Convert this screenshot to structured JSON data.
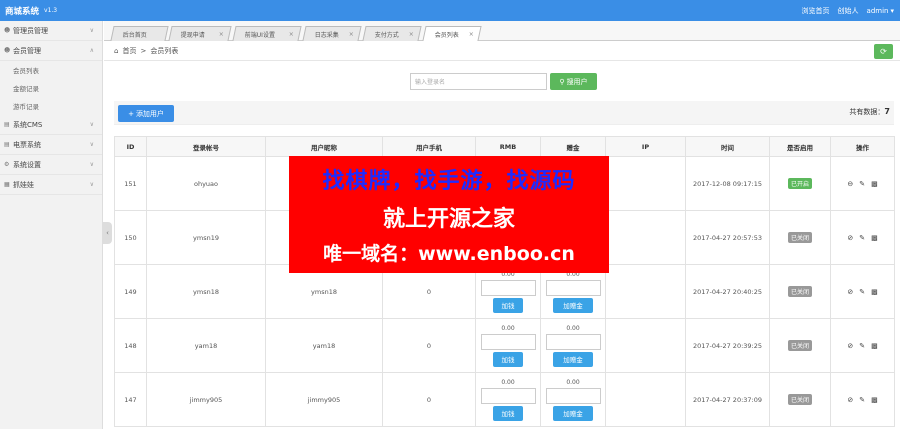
{
  "app": {
    "title": "商城系统",
    "version": "v1.3"
  },
  "header": {
    "links": [
      "浏览首页",
      "创始人"
    ],
    "user": "admin",
    "user_caret": "▾"
  },
  "sidebar": {
    "items": [
      {
        "label": "管理员管理",
        "icon": "user-icon"
      },
      {
        "label": "会员管理",
        "icon": "users-icon",
        "expanded": true,
        "children": [
          "会员列表",
          "金额记录",
          "游币记录"
        ]
      },
      {
        "label": "系统CMS",
        "icon": "cms-icon"
      },
      {
        "label": "电票系统",
        "icon": "ticket-icon"
      },
      {
        "label": "系统设置",
        "icon": "gear-icon"
      },
      {
        "label": "抓娃娃",
        "icon": "grid-icon"
      }
    ],
    "collapse_glyph": "‹"
  },
  "tabs": [
    {
      "label": "后台首页"
    },
    {
      "label": "提现申请"
    },
    {
      "label": "前端UI设置"
    },
    {
      "label": "日志采集"
    },
    {
      "label": "支付方式"
    },
    {
      "label": "会员列表",
      "active": true
    }
  ],
  "breadcrumb": {
    "home": "首页",
    "sep": ">",
    "current": "会员列表"
  },
  "search": {
    "placeholder": "输入登录名",
    "button_label": "搜用户",
    "button_icon": "search-icon"
  },
  "toolbar": {
    "add_label": "添加用户",
    "add_icon": "plus-icon",
    "total_label": "共有数据：",
    "total_value": "7"
  },
  "table": {
    "headers": [
      "ID",
      "登录帐号",
      "用户昵称",
      "用户手机",
      "RMB",
      "赠金",
      "IP",
      "时间",
      "是否启用",
      "操作"
    ],
    "rows": [
      {
        "id": "151",
        "login": "ohyuao",
        "nick": "",
        "phone": "",
        "rmb": "",
        "gift": "",
        "ip": "",
        "time": "2017-12-08 09:17:15",
        "status": "已开启",
        "status_type": "on"
      },
      {
        "id": "150",
        "login": "ymsn19",
        "nick": "",
        "phone": "",
        "rmb": "",
        "gift": "",
        "ip": "",
        "time": "2017-04-27 20:57:53",
        "status": "已关闭",
        "status_type": "off"
      },
      {
        "id": "149",
        "login": "ymsn18",
        "nick": "ymsn18",
        "phone": "0",
        "rmb": "0.00",
        "gift": "0.00",
        "ip": "",
        "time": "2017-04-27 20:40:25",
        "status": "已关闭",
        "status_type": "off"
      },
      {
        "id": "148",
        "login": "yam18",
        "nick": "yam18",
        "phone": "0",
        "rmb": "0.00",
        "gift": "0.00",
        "ip": "",
        "time": "2017-04-27 20:39:25",
        "status": "已关闭",
        "status_type": "off"
      },
      {
        "id": "147",
        "login": "jimmy905",
        "nick": "jimmy905",
        "phone": "0",
        "rmb": "0.00",
        "gift": "0.00",
        "ip": "",
        "time": "2017-04-27 20:37:09",
        "status": "已关闭",
        "status_type": "off"
      }
    ],
    "rmb_button": "加钱",
    "gift_button": "加赠金",
    "op_icons": [
      "toggle-icon",
      "edit-icon",
      "delete-icon"
    ]
  },
  "overlay": {
    "line1": "找棋牌，找手游，找源码",
    "line2": "就上开源之家",
    "line3": "唯一域名：www.enboo.cn"
  },
  "colors": {
    "topbar": "#3a8ee6",
    "green": "#5cb85c",
    "overlay_bg": "#ff0000",
    "overlay_blue": "#1e2bff"
  }
}
